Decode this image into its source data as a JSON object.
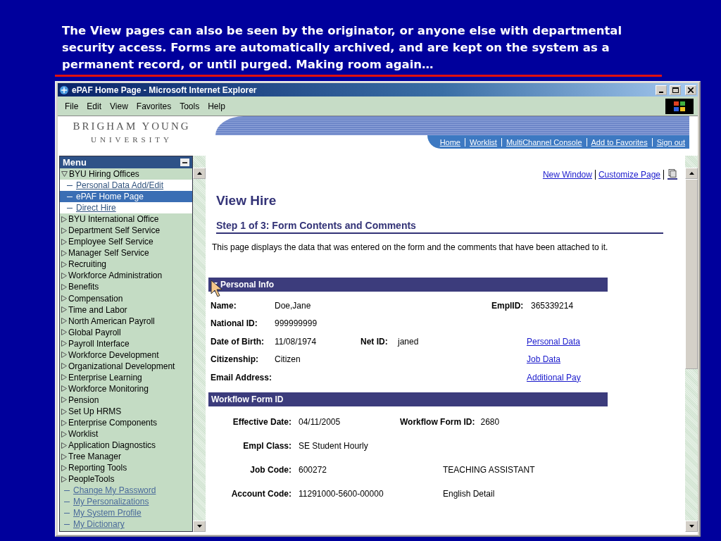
{
  "caption": "The View pages can also be seen by the originator, or anyone else with departmental security access. Forms are automatically archived, and are kept on the system as a permanent record, or until purged. Making room again…",
  "window": {
    "title": "ePAF Home Page - Microsoft Internet Explorer"
  },
  "menu_bar": [
    "File",
    "Edit",
    "View",
    "Favorites",
    "Tools",
    "Help"
  ],
  "header": {
    "logo_line_1": "BRIGHAM YOUNG",
    "logo_line_2": "UNIVERSITY",
    "nav_links": [
      "Home",
      "Worklist",
      "MultiChannel Console",
      "Add to Favorites",
      "Sign out"
    ]
  },
  "menu": {
    "title": "Menu",
    "items": [
      {
        "kind": "folder",
        "label": "BYU Hiring Offices",
        "expanded": true,
        "children": [
          {
            "kind": "link",
            "label": "Personal Data Add/Edit",
            "selected": false
          },
          {
            "kind": "link",
            "label": "ePAF Home Page",
            "selected": true
          },
          {
            "kind": "link",
            "label": "Direct Hire",
            "selected": false
          }
        ]
      },
      {
        "kind": "folder",
        "label": "BYU International Office",
        "expanded": false
      },
      {
        "kind": "folder",
        "label": "Department Self Service",
        "expanded": false
      },
      {
        "kind": "folder",
        "label": "Employee Self Service",
        "expanded": false
      },
      {
        "kind": "folder",
        "label": "Manager Self Service",
        "expanded": false
      },
      {
        "kind": "folder",
        "label": "Recruiting",
        "expanded": false
      },
      {
        "kind": "folder",
        "label": "Workforce Administration",
        "expanded": false
      },
      {
        "kind": "folder",
        "label": "Benefits",
        "expanded": false
      },
      {
        "kind": "folder",
        "label": "Compensation",
        "expanded": false
      },
      {
        "kind": "folder",
        "label": "Time and Labor",
        "expanded": false
      },
      {
        "kind": "folder",
        "label": "North American Payroll",
        "expanded": false
      },
      {
        "kind": "folder",
        "label": "Global Payroll",
        "expanded": false
      },
      {
        "kind": "folder",
        "label": "Payroll Interface",
        "expanded": false
      },
      {
        "kind": "folder",
        "label": "Workforce Development",
        "expanded": false
      },
      {
        "kind": "folder",
        "label": "Organizational Development",
        "expanded": false
      },
      {
        "kind": "folder",
        "label": "Enterprise Learning",
        "expanded": false
      },
      {
        "kind": "folder",
        "label": "Workforce Monitoring",
        "expanded": false
      },
      {
        "kind": "folder",
        "label": "Pension",
        "expanded": false
      },
      {
        "kind": "folder",
        "label": "Set Up HRMS",
        "expanded": false
      },
      {
        "kind": "folder",
        "label": "Enterprise Components",
        "expanded": false
      },
      {
        "kind": "folder",
        "label": "Worklist",
        "expanded": false
      },
      {
        "kind": "folder",
        "label": "Application Diagnostics",
        "expanded": false
      },
      {
        "kind": "folder",
        "label": "Tree Manager",
        "expanded": false
      },
      {
        "kind": "folder",
        "label": "Reporting Tools",
        "expanded": false
      },
      {
        "kind": "folder",
        "label": "PeopleTools",
        "expanded": false
      },
      {
        "kind": "link",
        "label": "Change My Password"
      },
      {
        "kind": "link",
        "label": "My Personalizations"
      },
      {
        "kind": "link",
        "label": "My System Profile"
      },
      {
        "kind": "link",
        "label": "My Dictionary"
      }
    ]
  },
  "page_links": [
    "New Window",
    "Customize Page"
  ],
  "page_title": "View Hire",
  "step_title": "Step 1 of 3: Form Contents and Comments",
  "description": "This page displays the data that was entered on the form and the comments that have been attached to it.",
  "personal_info": {
    "title": "Personal Info",
    "expanded": true,
    "rows": [
      {
        "label": "Name:",
        "value": "Doe,Jane",
        "label_3": "EmplID:",
        "value_3": "365339214"
      },
      {
        "label": "National ID:",
        "value": "999999999"
      },
      {
        "label": "Date of Birth:",
        "value": "11/08/1974",
        "label_2": "Net ID:",
        "value_2": "janed",
        "link": "Personal Data"
      },
      {
        "label": "Citizenship:",
        "value": "Citizen",
        "link": "Job Data"
      },
      {
        "label": "Email Address:",
        "link": "Additional Pay"
      }
    ]
  },
  "workflow": {
    "title": "Workflow Form ID",
    "rows": [
      {
        "label": "Effective Date:",
        "value": "04/11/2005",
        "label_2": "Workflow Form ID:",
        "value_2": "2680"
      },
      {
        "label": "Empl Class:",
        "value": "SE Student Hourly"
      },
      {
        "label": "Job Code:",
        "value": "600272",
        "description": "TEACHING ASSISTANT"
      },
      {
        "label": "Account Code:",
        "value": "11291000-5600-00000",
        "description": "English Detail"
      }
    ]
  }
}
